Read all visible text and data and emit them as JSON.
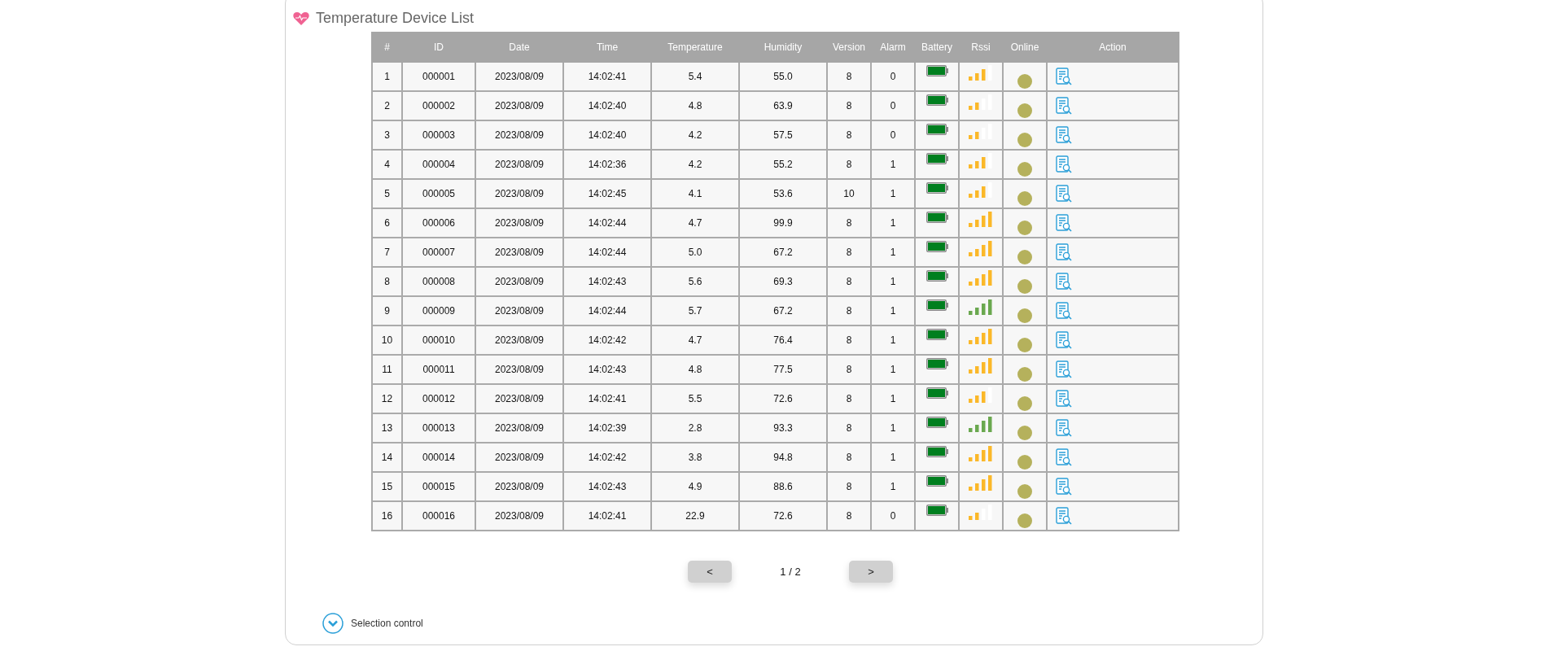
{
  "panel": {
    "title": "Temperature Device List"
  },
  "table": {
    "columns": [
      "#",
      "ID",
      "Date",
      "Time",
      "Temperature",
      "Humidity",
      "Version",
      "Alarm",
      "Battery",
      "Rssi",
      "Online",
      "Action"
    ],
    "rows": [
      {
        "no": "1",
        "id": "000001",
        "date": "2023/08/09",
        "time": "14:02:41",
        "temperature": "5.4",
        "humidity": "55.0",
        "version": "8",
        "alarm": "0",
        "kind": "fair",
        "online": true
      },
      {
        "no": "2",
        "id": "000002",
        "date": "2023/08/09",
        "time": "14:02:40",
        "temperature": "4.8",
        "humidity": "63.9",
        "version": "8",
        "alarm": "0",
        "kind": "weak",
        "online": true
      },
      {
        "no": "3",
        "id": "000003",
        "date": "2023/08/09",
        "time": "14:02:40",
        "temperature": "4.2",
        "humidity": "57.5",
        "version": "8",
        "alarm": "0",
        "kind": "weak",
        "online": true
      },
      {
        "no": "4",
        "id": "000004",
        "date": "2023/08/09",
        "time": "14:02:36",
        "temperature": "4.2",
        "humidity": "55.2",
        "version": "8",
        "alarm": "1",
        "kind": "fair",
        "online": true
      },
      {
        "no": "5",
        "id": "000005",
        "date": "2023/08/09",
        "time": "14:02:45",
        "temperature": "4.1",
        "humidity": "53.6",
        "version": "10",
        "alarm": "1",
        "kind": "fair",
        "online": true
      },
      {
        "no": "6",
        "id": "000006",
        "date": "2023/08/09",
        "time": "14:02:44",
        "temperature": "4.7",
        "humidity": "99.9",
        "version": "8",
        "alarm": "1",
        "kind": "good",
        "online": true
      },
      {
        "no": "7",
        "id": "000007",
        "date": "2023/08/09",
        "time": "14:02:44",
        "temperature": "5.0",
        "humidity": "67.2",
        "version": "8",
        "alarm": "1",
        "kind": "good",
        "online": true
      },
      {
        "no": "8",
        "id": "000008",
        "date": "2023/08/09",
        "time": "14:02:43",
        "temperature": "5.6",
        "humidity": "69.3",
        "version": "8",
        "alarm": "1",
        "kind": "good",
        "online": true
      },
      {
        "no": "9",
        "id": "000009",
        "date": "2023/08/09",
        "time": "14:02:44",
        "temperature": "5.7",
        "humidity": "67.2",
        "version": "8",
        "alarm": "1",
        "kind": "excellent",
        "online": true
      },
      {
        "no": "10",
        "id": "000010",
        "date": "2023/08/09",
        "time": "14:02:42",
        "temperature": "4.7",
        "humidity": "76.4",
        "version": "8",
        "alarm": "1",
        "kind": "good",
        "online": true
      },
      {
        "no": "11",
        "id": "000011",
        "date": "2023/08/09",
        "time": "14:02:43",
        "temperature": "4.8",
        "humidity": "77.5",
        "version": "8",
        "alarm": "1",
        "kind": "good",
        "online": true
      },
      {
        "no": "12",
        "id": "000012",
        "date": "2023/08/09",
        "time": "14:02:41",
        "temperature": "5.5",
        "humidity": "72.6",
        "version": "8",
        "alarm": "1",
        "kind": "fair",
        "online": true
      },
      {
        "no": "13",
        "id": "000013",
        "date": "2023/08/09",
        "time": "14:02:39",
        "temperature": "2.8",
        "humidity": "93.3",
        "version": "8",
        "alarm": "1",
        "kind": "excellent",
        "online": true
      },
      {
        "no": "14",
        "id": "000014",
        "date": "2023/08/09",
        "time": "14:02:42",
        "temperature": "3.8",
        "humidity": "94.8",
        "version": "8",
        "alarm": "1",
        "kind": "good",
        "online": true
      },
      {
        "no": "15",
        "id": "000015",
        "date": "2023/08/09",
        "time": "14:02:43",
        "temperature": "4.9",
        "humidity": "88.6",
        "version": "8",
        "alarm": "1",
        "kind": "good",
        "online": true
      },
      {
        "no": "16",
        "id": "000016",
        "date": "2023/08/09",
        "time": "14:02:41",
        "temperature": "22.9",
        "humidity": "72.6",
        "version": "8",
        "alarm": "0",
        "kind": "weak",
        "online": true
      }
    ]
  },
  "pagination": {
    "previous": "<",
    "page": "1 / 2",
    "next": ">"
  },
  "selection_control": {
    "label": "Selection control",
    "expanded": false
  }
}
